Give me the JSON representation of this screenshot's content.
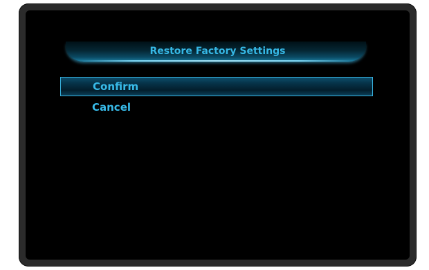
{
  "dialog": {
    "title": "Restore Factory Settings",
    "options": [
      {
        "label": "Confirm",
        "selected": true
      },
      {
        "label": "Cancel",
        "selected": false
      }
    ]
  },
  "colors": {
    "text_accent": "#38bbe9",
    "highlight_border": "#3ab6e4",
    "screen_background": "#000000",
    "bezel": "#2b2b2b"
  }
}
